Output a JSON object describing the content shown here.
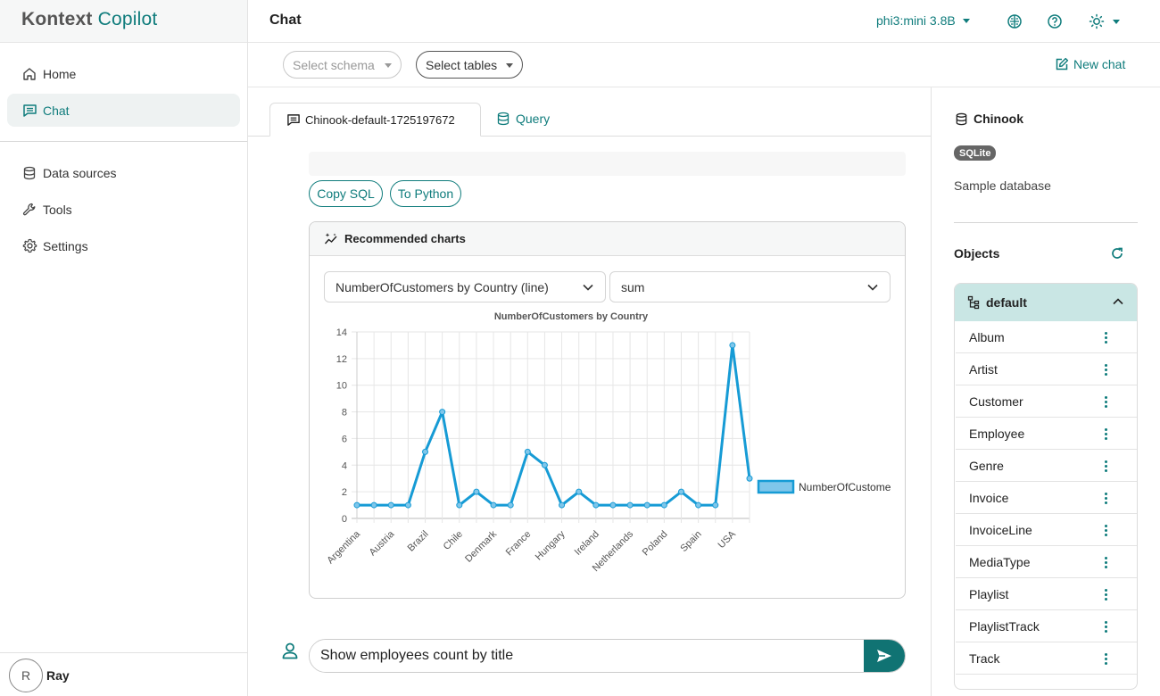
{
  "brand": {
    "part1": "Konte",
    "part2": "xt",
    "part3": " Copilot"
  },
  "sidebar": {
    "items": [
      {
        "label": "Home",
        "icon": "home-icon"
      },
      {
        "label": "Chat",
        "icon": "chat-icon",
        "active": true
      },
      {
        "label": "Data sources",
        "icon": "database-icon"
      },
      {
        "label": "Tools",
        "icon": "wrench-icon"
      },
      {
        "label": "Settings",
        "icon": "gear-icon"
      }
    ],
    "user": {
      "initial": "R",
      "name": "Ray"
    }
  },
  "header": {
    "title": "Chat",
    "model": "phi3:mini 3.8B"
  },
  "toolbar": {
    "schema_placeholder": "Select schema",
    "tables_placeholder": "Select tables",
    "new_chat": "New chat"
  },
  "tabs": {
    "chat": "Chinook-default-1725197672",
    "query": "Query"
  },
  "actions": {
    "copy_sql": "Copy SQL",
    "to_python": "To Python"
  },
  "charts_panel": {
    "title": "Recommended charts",
    "chart_select": "NumberOfCustomers by Country (line)",
    "agg_select": "sum"
  },
  "chart_data": {
    "type": "line",
    "title": "NumberOfCustomers by Country",
    "legend": "NumberOfCustome",
    "legend_position": "right",
    "grid": true,
    "ylim": [
      0,
      14
    ],
    "yticks": [
      0,
      2,
      4,
      6,
      8,
      10,
      12,
      14
    ],
    "x_tick_labels": [
      "Argentina",
      "Austria",
      "Brazil",
      "Chile",
      "Denmark",
      "France",
      "Hungary",
      "Ireland",
      "Netherlands",
      "Poland",
      "Spain",
      "USA"
    ],
    "series": [
      {
        "color": "#169bd5",
        "values": [
          1,
          1,
          1,
          1,
          5,
          8,
          1,
          2,
          1,
          1,
          5,
          4,
          1,
          2,
          1,
          1,
          1,
          1,
          1,
          2,
          1,
          1,
          13,
          3
        ]
      }
    ]
  },
  "input": {
    "value": "Show employees count by title"
  },
  "right_panel": {
    "db_name": "Chinook",
    "db_type": "SQLite",
    "description": "Sample database",
    "objects_title": "Objects",
    "schema": "default",
    "tables": [
      "Album",
      "Artist",
      "Customer",
      "Employee",
      "Genre",
      "Invoice",
      "InvoiceLine",
      "MediaType",
      "Playlist",
      "PlaylistTrack",
      "Track"
    ]
  },
  "colors": {
    "accent": "#0f7c7c",
    "line": "#169bd5",
    "send": "#107373"
  }
}
